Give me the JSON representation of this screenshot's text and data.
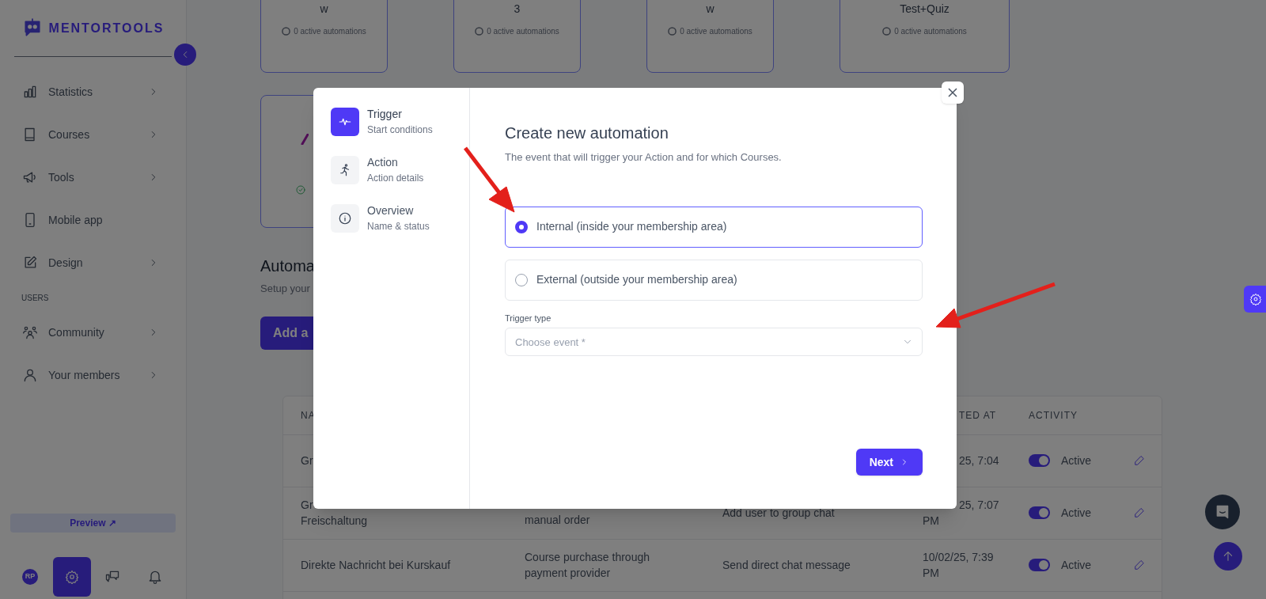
{
  "sidebar": {
    "logo": "MENTORTOOLS",
    "items": [
      {
        "label": "Statistics",
        "expandable": true
      },
      {
        "label": "Courses",
        "expandable": true
      },
      {
        "label": "Tools",
        "expandable": true
      },
      {
        "label": "Mobile app",
        "expandable": false
      },
      {
        "label": "Design",
        "expandable": true
      },
      {
        "kind": "section",
        "label": "USERS"
      },
      {
        "label": "Community",
        "expandable": true
      },
      {
        "label": "Your members",
        "expandable": true
      }
    ],
    "preview_button": "Preview ↗",
    "avatar": "RP"
  },
  "cards": [
    {
      "title": "w",
      "status": "0 active automations"
    },
    {
      "title": "3",
      "status": "0 active automations"
    },
    {
      "title": "w",
      "status": "0 active automations"
    },
    {
      "title": "Test+Quiz",
      "status": "0 active automations"
    }
  ],
  "section": {
    "title": "Automa",
    "subtitle": "Setup your",
    "add_button": "Add a"
  },
  "table": {
    "columns": [
      "NA",
      "TED AT",
      "ACTIVITY"
    ],
    "rows": [
      {
        "name": [
          "Gr"
        ],
        "date": [
          "25, 7:04"
        ],
        "active": true,
        "status": "Active"
      },
      {
        "name": [
          "Gr",
          "Freischaltung"
        ],
        "trigger": [
          "manual order"
        ],
        "action": [
          "Add user to group chat"
        ],
        "date": [
          "25, 7:07",
          "PM"
        ],
        "active": true,
        "status": "Active"
      },
      {
        "name": [
          "Direkte Nachricht bei Kurskauf"
        ],
        "trigger": [
          "Course purchase through",
          "payment provider"
        ],
        "action": [
          "Send direct chat message"
        ],
        "date": [
          "10/02/25, 7:39",
          "PM"
        ],
        "active": true,
        "status": "Active"
      }
    ]
  },
  "modal": {
    "steps": [
      {
        "title": "Trigger",
        "subtitle": "Start conditions",
        "selected": true
      },
      {
        "title": "Action",
        "subtitle": "Action details",
        "selected": false
      },
      {
        "title": "Overview",
        "subtitle": "Name & status",
        "selected": false
      }
    ],
    "title": "Create new automation",
    "subtitle": "The event that will trigger your Action and for which Courses.",
    "options": [
      {
        "label": "Internal (inside your membership area)",
        "selected": true
      },
      {
        "label": "External (outside your membership area)",
        "selected": false
      }
    ],
    "trigger_type": {
      "label": "Trigger type",
      "placeholder": "Choose event *"
    },
    "next_button": "Next"
  }
}
